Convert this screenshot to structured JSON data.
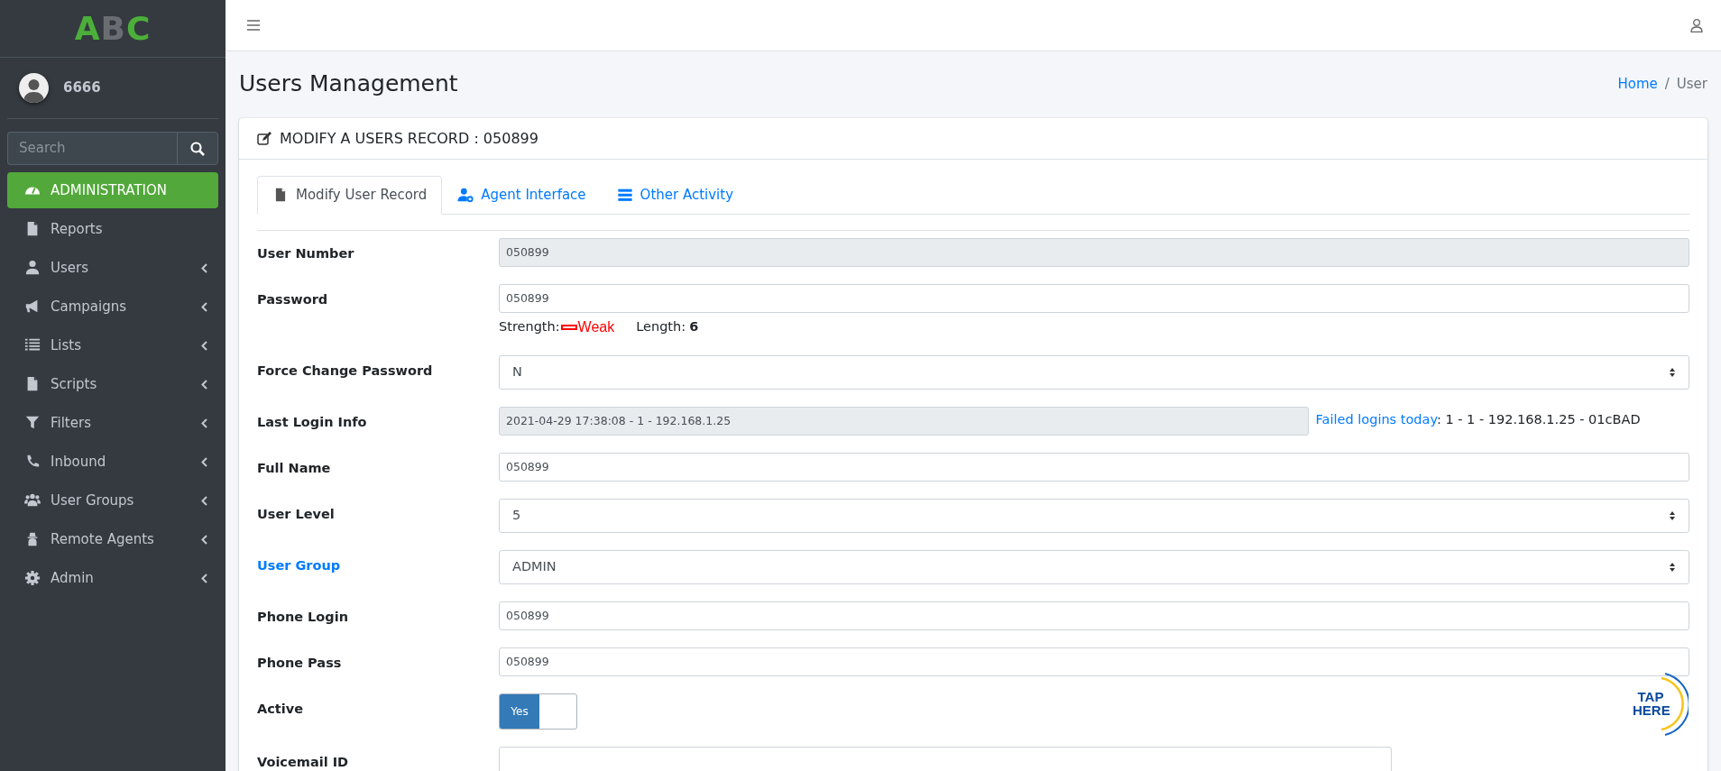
{
  "sidebar": {
    "logo": [
      {
        "text": "A",
        "color": "#4caf3a"
      },
      {
        "text": "B",
        "color": "#6a6e72"
      },
      {
        "text": "C",
        "color": "#4caf3a"
      }
    ],
    "user": {
      "name": "6666"
    },
    "search": {
      "placeholder": "Search"
    },
    "items": [
      {
        "label": "ADMINISTRATION",
        "kind": "gauge",
        "selected": true,
        "expandable": false
      },
      {
        "label": "Reports",
        "kind": "document",
        "selected": false,
        "expandable": false
      },
      {
        "label": "Users",
        "kind": "user",
        "selected": false,
        "expandable": true
      },
      {
        "label": "Campaigns",
        "kind": "megaphone",
        "selected": false,
        "expandable": true
      },
      {
        "label": "Lists",
        "kind": "list",
        "selected": false,
        "expandable": true
      },
      {
        "label": "Scripts",
        "kind": "document",
        "selected": false,
        "expandable": true
      },
      {
        "label": "Filters",
        "kind": "filter",
        "selected": false,
        "expandable": true
      },
      {
        "label": "Inbound",
        "kind": "phone",
        "selected": false,
        "expandable": true
      },
      {
        "label": "User Groups",
        "kind": "users",
        "selected": false,
        "expandable": true
      },
      {
        "label": "Remote Agents",
        "kind": "agent",
        "selected": false,
        "expandable": true
      },
      {
        "label": "Admin",
        "kind": "gear",
        "selected": false,
        "expandable": true
      }
    ]
  },
  "page": {
    "title": "Users Management",
    "breadcrumb_separator": "/",
    "breadcrumb": [
      {
        "label": "Home",
        "selected": false
      },
      {
        "label": "User",
        "selected": true
      }
    ]
  },
  "card": {
    "title": "MODIFY A USERS RECORD : 050899",
    "tabs": [
      {
        "label": "Modify User Record",
        "kind": "document",
        "selected": true
      },
      {
        "label": "Agent Interface",
        "kind": "user-gear",
        "selected": false
      },
      {
        "label": "Other Activity",
        "kind": "bars",
        "selected": false
      }
    ],
    "fields": [
      {
        "label": "User Number",
        "kind": "readonly",
        "value": "050899"
      },
      {
        "label": "Password",
        "kind": "password",
        "value": "050899",
        "strength_label": "Strength:",
        "strength": "Weak",
        "length_label": "Length:",
        "length": "6"
      },
      {
        "label": "Force Change Password",
        "kind": "select",
        "value": "N"
      },
      {
        "label": "Last Login Info",
        "kind": "readonly-note",
        "value": "2021-04-29 17:38:08 - 1 - 192.168.1.25",
        "note_link": "Failed logins today",
        "note": ": 1 - 1 - 192.168.1.25 - 01cBAD"
      },
      {
        "label": "Full Name",
        "kind": "input",
        "value": "050899"
      },
      {
        "label": "User Level",
        "kind": "select",
        "value": "5"
      },
      {
        "label": "User Group",
        "kind": "select",
        "value": "ADMIN",
        "link": true
      },
      {
        "label": "Phone Login",
        "kind": "input",
        "value": "050899"
      },
      {
        "label": "Phone Pass",
        "kind": "input",
        "value": "050899"
      },
      {
        "label": "Active",
        "kind": "toggle",
        "value": "Yes",
        "on": true
      },
      {
        "label": "Voicemail ID",
        "kind": "input-short"
      }
    ]
  },
  "tap_badge": {
    "text": "TAP HERE"
  }
}
